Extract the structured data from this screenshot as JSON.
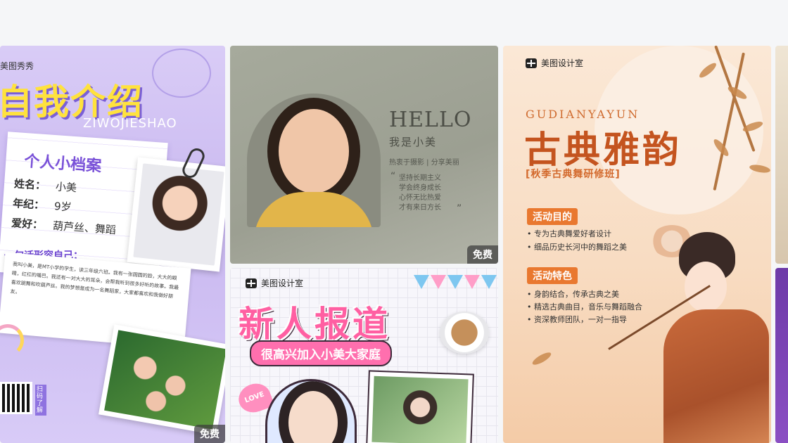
{
  "cards": {
    "intro": {
      "brand": "美图秀秀",
      "title": "自我介绍",
      "subtitle": "ZIWOJIESHAO",
      "profile_title": "个人小档案",
      "fields": [
        {
          "label": "姓名：",
          "value": "小美"
        },
        {
          "label": "年纪：",
          "value": "9岁"
        },
        {
          "label": "爱好：",
          "value": "葫芦丝、舞蹈"
        }
      ],
      "slogan": "一句话形容自己：",
      "note": "我叫小美，是MT小学的学生，读三年级六班。我有一张圆圆的脸，大大的眼睛，红红的嘴巴。我还有一对大大的耳朵，会帮我听到很多好听的故事。我最喜欢跳舞和吹葫芦丝。我的梦想是成为一名舞蹈家，大家都喜欢和我做好朋友。",
      "qr_label": "扫码了解",
      "badge": "免费"
    },
    "hello": {
      "heading": "HELLO",
      "intro": "我是小美",
      "tagline": "热衷于摄影 | 分享美丽",
      "quote_lines": [
        "坚持长期主义",
        "学会终身成长",
        "心怀无比热爱",
        "才有来日方长"
      ],
      "badge": "免费"
    },
    "newcomer": {
      "brand": "美图设计室",
      "title": "新人报道",
      "subtitle": "很高兴加入小美大家庭",
      "love": "LOVE"
    },
    "classical": {
      "brand": "美图设计室",
      "pinyin": "GUDIANYAYUN",
      "title": "古典雅韵",
      "class_name": "[秋季古典舞研修班]",
      "sections": [
        {
          "title": "活动目的",
          "items": [
            "• 专为古典舞爱好者设计",
            "• 细品历史长河中的舞蹈之美"
          ]
        },
        {
          "title": "活动特色",
          "items": [
            "• 身韵结合，传承古典之美",
            "• 精选古典曲目，音乐与舞蹈融合",
            "• 资深教师团队，一对一指导"
          ]
        }
      ]
    }
  },
  "colors": {
    "intro_title": "#ffe23d",
    "intro_accent": "#7a52d8",
    "newcomer_pink": "#ff5fa2",
    "classical_orange": "#c4541f",
    "badge_bg": "#3c3c3c"
  }
}
